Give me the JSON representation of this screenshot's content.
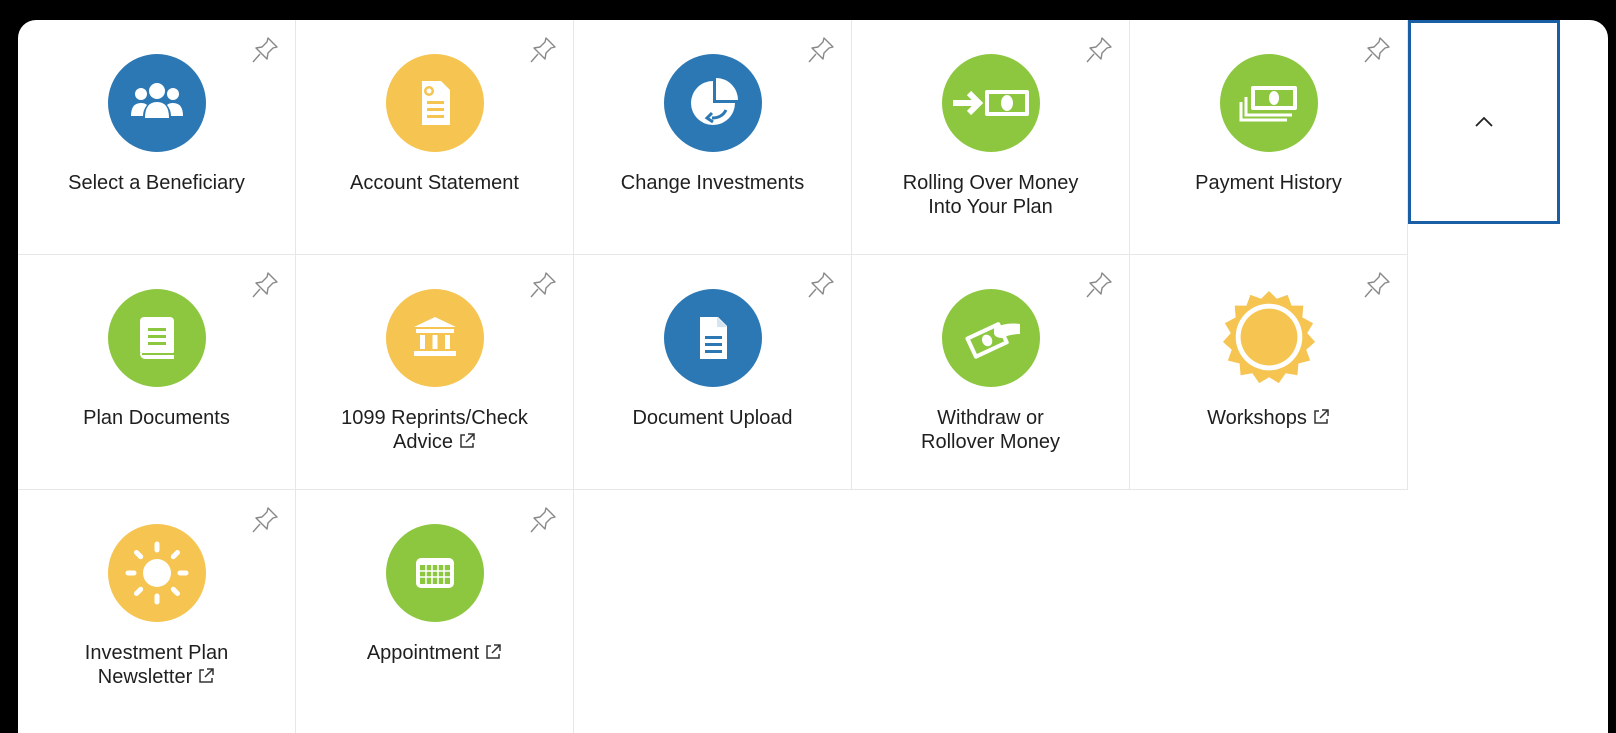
{
  "colors": {
    "blue": "#2c78b4",
    "yellow": "#f5c451",
    "green": "#8dc740",
    "focus": "#1a5ea6"
  },
  "tiles": [
    {
      "label": "Select a Beneficiary",
      "label2": "",
      "external": false,
      "icon": "people-icon",
      "color": "blue"
    },
    {
      "label": "Account Statement",
      "label2": "",
      "external": false,
      "icon": "statement-icon",
      "color": "yellow"
    },
    {
      "label": "Change Investments",
      "label2": "",
      "external": false,
      "icon": "pie-chart-arrow-icon",
      "color": "blue"
    },
    {
      "label": "Rolling Over Money",
      "label2": "Into Your Plan",
      "external": false,
      "icon": "money-arrow-icon",
      "color": "green"
    },
    {
      "label": "Payment History",
      "label2": "",
      "external": false,
      "icon": "stacked-money-icon",
      "color": "green"
    },
    {
      "label": "Plan Documents",
      "label2": "",
      "external": false,
      "icon": "book-icon",
      "color": "green"
    },
    {
      "label": "1099 Reprints/Check",
      "label2": "Advice",
      "external": true,
      "icon": "bank-icon",
      "color": "yellow"
    },
    {
      "label": "Document Upload",
      "label2": "",
      "external": false,
      "icon": "document-icon",
      "color": "blue"
    },
    {
      "label": "Withdraw or",
      "label2": "Rollover Money",
      "external": false,
      "icon": "hand-money-icon",
      "color": "green"
    },
    {
      "label": "Workshops",
      "label2": "",
      "external": true,
      "icon": "sun-badge-icon",
      "color": "yellow"
    },
    {
      "label": "Investment Plan",
      "label2": "Newsletter",
      "external": true,
      "icon": "sun-icon",
      "color": "yellow"
    },
    {
      "label": "Appointment",
      "label2": "",
      "external": true,
      "icon": "calendar-icon",
      "color": "green"
    }
  ],
  "collapse_button": {
    "icon": "chevron-up-icon"
  }
}
